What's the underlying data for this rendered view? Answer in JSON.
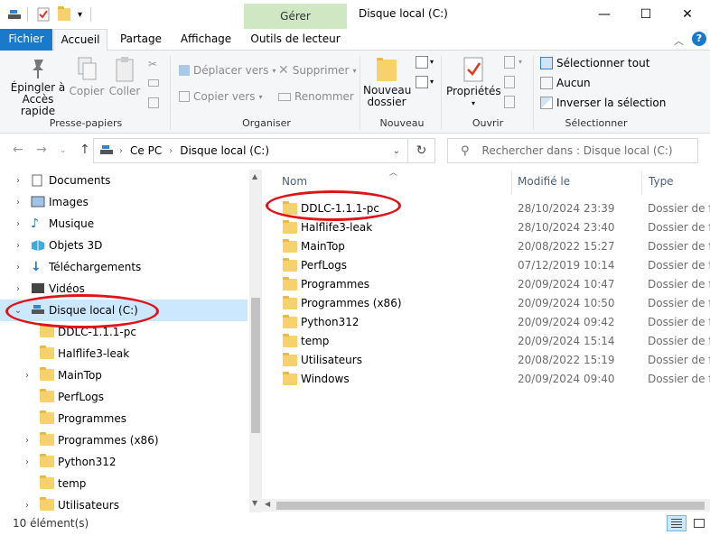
{
  "window": {
    "title": "Disque local (C:)",
    "context_tab": "Gérer",
    "controls": [
      "—",
      "☐",
      "✕"
    ]
  },
  "tabs": {
    "file": "Fichier",
    "home": "Accueil",
    "share": "Partage",
    "view": "Affichage",
    "drive_tools": "Outils de lecteur"
  },
  "ribbon": {
    "clipboard": {
      "pin_line1": "Épingler à",
      "pin_line2": "Accès rapide",
      "copy": "Copier",
      "paste": "Coller",
      "label": "Presse-papiers"
    },
    "organize": {
      "move_to": "Déplacer vers",
      "copy_to": "Copier vers",
      "delete": "Supprimer",
      "rename": "Renommer",
      "label": "Organiser"
    },
    "new": {
      "new_folder_line1": "Nouveau",
      "new_folder_line2": "dossier",
      "label": "Nouveau"
    },
    "open": {
      "properties": "Propriétés",
      "label": "Ouvrir"
    },
    "select": {
      "select_all": "Sélectionner tout",
      "select_none": "Aucun",
      "invert": "Inverser la sélection",
      "label": "Sélectionner"
    }
  },
  "address": {
    "breadcrumb": [
      "Ce PC",
      "Disque local (C:)"
    ],
    "search_placeholder": "Rechercher dans : Disque local (C:)"
  },
  "nav": {
    "items": [
      {
        "label": "Documents",
        "icon": "documents-icon",
        "level": 0
      },
      {
        "label": "Images",
        "icon": "images-icon",
        "level": 0
      },
      {
        "label": "Musique",
        "icon": "music-icon",
        "level": 0
      },
      {
        "label": "Objets 3D",
        "icon": "objects3d-icon",
        "level": 0
      },
      {
        "label": "Téléchargements",
        "icon": "downloads-icon",
        "level": 0
      },
      {
        "label": "Vidéos",
        "icon": "videos-icon",
        "level": 0
      },
      {
        "label": "Disque local (C:)",
        "icon": "drive-icon",
        "level": 0,
        "selected": true,
        "expanded": true
      },
      {
        "label": "DDLC-1.1.1-pc",
        "icon": "folder-icon",
        "level": 1
      },
      {
        "label": "Halflife3-leak",
        "icon": "folder-icon",
        "level": 1
      },
      {
        "label": "MainTop",
        "icon": "folder-icon",
        "level": 1
      },
      {
        "label": "PerfLogs",
        "icon": "folder-icon",
        "level": 1
      },
      {
        "label": "Programmes",
        "icon": "folder-icon",
        "level": 1
      },
      {
        "label": "Programmes (x86)",
        "icon": "folder-icon",
        "level": 1
      },
      {
        "label": "Python312",
        "icon": "folder-icon",
        "level": 1
      },
      {
        "label": "temp",
        "icon": "folder-icon",
        "level": 1
      },
      {
        "label": "Utilisateurs",
        "icon": "folder-icon",
        "level": 1
      }
    ]
  },
  "columns": {
    "name": "Nom",
    "modified": "Modifié le",
    "type": "Type"
  },
  "files": [
    {
      "name": "DDLC-1.1.1-pc",
      "modified": "28/10/2024 23:39",
      "type": "Dossier de fichiers"
    },
    {
      "name": "Halflife3-leak",
      "modified": "28/10/2024 23:40",
      "type": "Dossier de fichiers"
    },
    {
      "name": "MainTop",
      "modified": "20/08/2022 15:27",
      "type": "Dossier de fichiers"
    },
    {
      "name": "PerfLogs",
      "modified": "07/12/2019 10:14",
      "type": "Dossier de fichiers"
    },
    {
      "name": "Programmes",
      "modified": "20/09/2024 10:47",
      "type": "Dossier de fichiers"
    },
    {
      "name": "Programmes (x86)",
      "modified": "20/09/2024 10:50",
      "type": "Dossier de fichiers"
    },
    {
      "name": "Python312",
      "modified": "20/09/2024 09:42",
      "type": "Dossier de fichiers"
    },
    {
      "name": "temp",
      "modified": "20/09/2024 15:14",
      "type": "Dossier de fichiers"
    },
    {
      "name": "Utilisateurs",
      "modified": "20/08/2022 15:19",
      "type": "Dossier de fichiers"
    },
    {
      "name": "Windows",
      "modified": "20/09/2024 09:40",
      "type": "Dossier de fichiers"
    }
  ],
  "status": {
    "count": "10 élément(s)"
  },
  "colors": {
    "file_tab": "#1979ca",
    "context_tab": "#cfe8c3",
    "selection": "#cce8ff",
    "annotation": "#e0121a",
    "folder": "#f7d16b"
  }
}
